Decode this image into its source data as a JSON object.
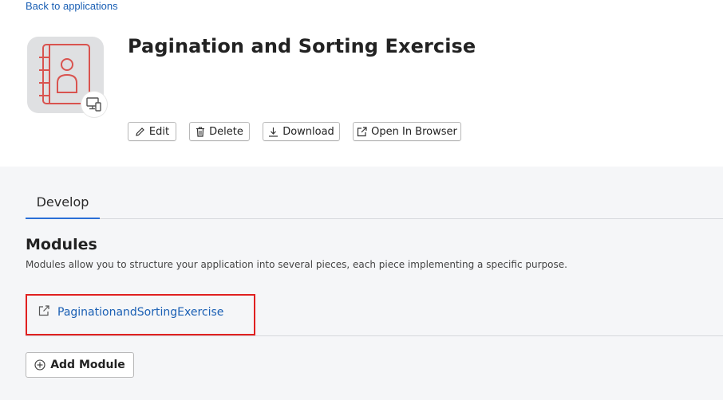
{
  "header": {
    "back_link": "Back to applications",
    "app_title": "Pagination and Sorting Exercise",
    "app_icon": "address-book-icon",
    "platform_badge": "devices-icon"
  },
  "actions": {
    "edit": "Edit",
    "delete": "Delete",
    "download": "Download",
    "open_in_browser": "Open In Browser"
  },
  "tabs": [
    {
      "label": "Develop",
      "active": true
    }
  ],
  "modules": {
    "title": "Modules",
    "description": "Modules allow you to structure your application into several pieces, each piece implementing a specific purpose.",
    "items": [
      {
        "name": "PaginationandSortingExercise",
        "icon": "external-link-icon"
      }
    ],
    "add_button": "Add Module"
  },
  "colors": {
    "link": "#1a5fb4",
    "accent": "#2a6fd6",
    "highlight_border": "#e02020",
    "icon_red": "#d9534f",
    "panel_bg": "#f5f6f8"
  }
}
